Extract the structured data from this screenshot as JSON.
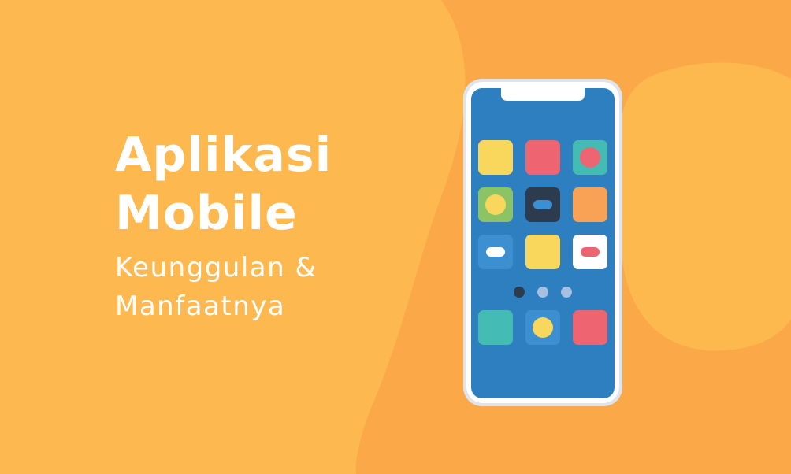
{
  "headline": {
    "title_line_1": "Aplikasi",
    "title_line_2": "Mobile",
    "subtitle_line_1": "Keunggulan &",
    "subtitle_line_2": "Manfaatnya"
  },
  "colors": {
    "background_light": "#fdb94f",
    "background_dark": "#fba848",
    "text": "#ffffff",
    "phone_frame": "#dfe3ea",
    "phone_screen": "#2e7fc0",
    "icon_yellow": "#f9d75c",
    "icon_red": "#ef6471",
    "icon_teal": "#45bcb3",
    "icon_green": "#8cc365",
    "icon_dark": "#2d3b4f",
    "icon_orange": "#f9a255",
    "icon_blue": "#3c8fd1",
    "icon_white": "#ffffff"
  },
  "phone": {
    "icons": [
      "app-tile-yellow-icon",
      "app-tile-red-icon",
      "app-tile-teal-red-dot-icon",
      "app-tile-green-yellow-dot-icon",
      "app-tile-dark-blue-pill-icon",
      "app-tile-orange-icon",
      "app-tile-blue-white-pill-icon",
      "app-tile-yellow-icon",
      "app-tile-white-red-pill-icon",
      "app-tile-teal-icon",
      "app-tile-blue-yellow-dot-icon",
      "app-tile-red-icon"
    ],
    "page_dots": 3
  }
}
